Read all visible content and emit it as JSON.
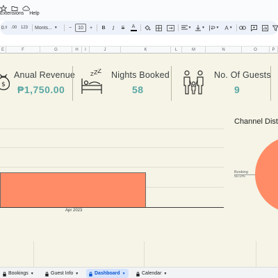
{
  "menu": {
    "extensions": "Extensions",
    "help": "Help"
  },
  "toolbar": {
    "zoom_fragment": "0.",
    "format_number": "123",
    "font": "Monts...",
    "font_size": "10",
    "minus": "−",
    "plus": "+",
    "bold": "B",
    "italic": "I",
    "strikethrough": "S",
    "text_color": "A"
  },
  "columns": [
    "E",
    "F",
    "G",
    "H",
    "I",
    "J",
    "K",
    "L",
    "M",
    "N",
    "O",
    "P"
  ],
  "kpis": [
    {
      "label": "Anual Revenue",
      "value": "₱1,750.00",
      "icon": "money-bag-icon"
    },
    {
      "label": "Nights Booked",
      "value": "58",
      "icon": "bed-sleep-icon"
    },
    {
      "label": "No. Of Guests",
      "value": "9",
      "icon": "family-icon"
    }
  ],
  "bar_chart": {
    "x_label": "Apr 2023",
    "bar_color": "#ff8c66"
  },
  "pie_chart": {
    "title": "Channel Dist",
    "slice_label": "Booking",
    "slice_pct": "50.0%",
    "slice_color": "#ff8c66"
  },
  "tabs": [
    {
      "label": "Bookings",
      "active": false
    },
    {
      "label": "Guest Info",
      "active": false
    },
    {
      "label": "Dashboard",
      "active": true
    },
    {
      "label": "Calendar",
      "active": false
    }
  ],
  "colors": {
    "dashboard_bg": "#f5f4e6",
    "kpi_value": "#5aa7a4",
    "accent": "#ff8c66"
  }
}
